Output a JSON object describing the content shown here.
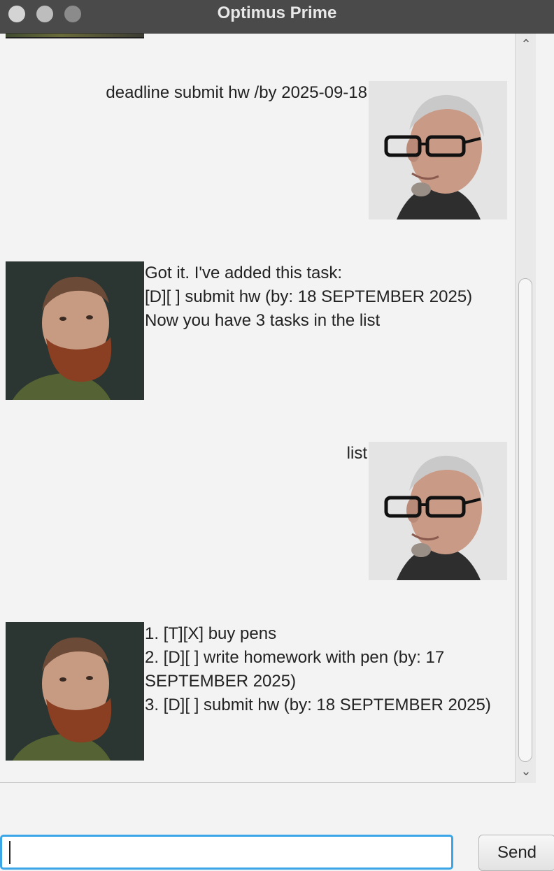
{
  "window": {
    "title": "Optimus Prime"
  },
  "dialog": {
    "user_message_1": "deadline submit hw /by 2025-09-18",
    "bot_reply_1": [
      "Got it. I've added this task:",
      "[D][ ] submit hw (by: 18 SEPTEMBER 2025)",
      "Now you have 3 tasks in the list"
    ],
    "user_message_2": "list",
    "bot_reply_2": [
      "1. [T][X] buy pens",
      "2. [D][ ] write homework with pen (by: 17",
      "SEPTEMBER 2025)",
      "3. [D][ ] submit hw (by: 18 SEPTEMBER 2025)"
    ]
  },
  "input": {
    "value": "",
    "placeholder": ""
  },
  "send_button": {
    "label": "Send"
  },
  "icons": {
    "user_avatar": "user-avatar-photo",
    "bot_avatar": "bot-avatar-photo"
  }
}
